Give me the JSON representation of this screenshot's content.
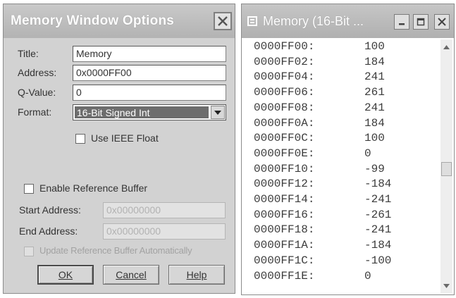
{
  "dialog": {
    "title": "Memory Window Options",
    "close_icon": "close-icon",
    "fields": {
      "title_label": "Title:",
      "title_value": "Memory",
      "address_label": "Address:",
      "address_value": "0x0000FF00",
      "qvalue_label": "Q-Value:",
      "qvalue_value": "0",
      "format_label": "Format:",
      "format_value": "16-Bit Signed Int"
    },
    "use_ieee_float_label": "Use IEEE Float",
    "enable_reference_buffer_label": "Enable Reference Buffer",
    "start_address_label": "Start Address:",
    "start_address_value": "0x00000000",
    "end_address_label": "End Address:",
    "end_address_value": "0x00000000",
    "update_reference_label": "Update Reference Buffer Automatically",
    "buttons": {
      "ok": "OK",
      "cancel": "Cancel",
      "help": "Help"
    }
  },
  "memory_window": {
    "title": "Memory (16-Bit ...",
    "rows": [
      {
        "address": "0000FF00:",
        "value": "100"
      },
      {
        "address": "0000FF02:",
        "value": "184"
      },
      {
        "address": "0000FF04:",
        "value": "241"
      },
      {
        "address": "0000FF06:",
        "value": "261"
      },
      {
        "address": "0000FF08:",
        "value": "241"
      },
      {
        "address": "0000FF0A:",
        "value": "184"
      },
      {
        "address": "0000FF0C:",
        "value": "100"
      },
      {
        "address": "0000FF0E:",
        "value": "0"
      },
      {
        "address": "0000FF10:",
        "value": "-99"
      },
      {
        "address": "0000FF12:",
        "value": "-184"
      },
      {
        "address": "0000FF14:",
        "value": "-241"
      },
      {
        "address": "0000FF16:",
        "value": "-261"
      },
      {
        "address": "0000FF18:",
        "value": "-241"
      },
      {
        "address": "0000FF1A:",
        "value": "-184"
      },
      {
        "address": "0000FF1C:",
        "value": "-100"
      },
      {
        "address": "0000FF1E:",
        "value": "0"
      }
    ]
  },
  "colors": {
    "titlebar": "#b9b9b9",
    "dialog_bg": "#d2d2d2",
    "selected_format": "#6d6d6d"
  }
}
